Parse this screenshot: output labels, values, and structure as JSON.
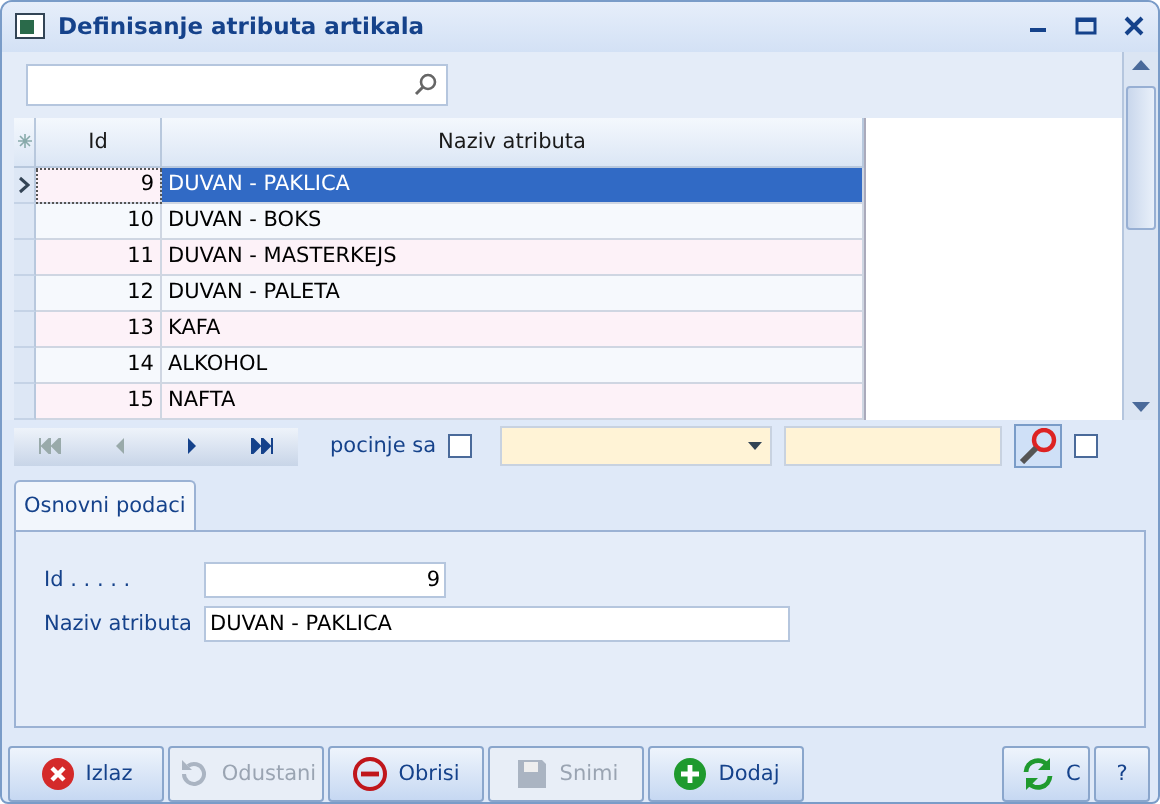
{
  "window": {
    "title": "Definisanje atributa artikala"
  },
  "grid": {
    "columns": [
      "Id",
      "Naziv atributa"
    ],
    "rows": [
      {
        "id": "9",
        "name": "DUVAN - PAKLICA",
        "selected": true
      },
      {
        "id": "10",
        "name": "DUVAN - BOKS",
        "selected": false
      },
      {
        "id": "11",
        "name": "DUVAN - MASTERKEJS",
        "selected": false
      },
      {
        "id": "12",
        "name": "DUVAN - PALETA",
        "selected": false
      },
      {
        "id": "13",
        "name": "KAFA",
        "selected": false
      },
      {
        "id": "14",
        "name": "ALKOHOL",
        "selected": false
      },
      {
        "id": "15",
        "name": "NAFTA",
        "selected": false
      }
    ]
  },
  "filter": {
    "label": "pocinje sa",
    "starts_with_checked": false,
    "extra_checked": false
  },
  "tabs": [
    {
      "label": "Osnovni podaci",
      "selected": true
    }
  ],
  "form": [
    {
      "label": "Id . . . . .",
      "value": "9",
      "kind": "number"
    },
    {
      "label": "Naziv atributa",
      "value": "DUVAN - PAKLICA",
      "kind": "text"
    }
  ],
  "buttons": [
    {
      "label": "Izlaz",
      "kind": "exit",
      "disabled": false
    },
    {
      "label": "Odustani",
      "kind": "undo",
      "disabled": true
    },
    {
      "label": "Obrisi",
      "kind": "delete",
      "disabled": false
    },
    {
      "label": "Snimi",
      "kind": "save",
      "disabled": true
    },
    {
      "label": "Dodaj",
      "kind": "add",
      "disabled": false
    }
  ],
  "refresh_button": {
    "label": "C"
  },
  "help_button": {
    "label": "?"
  }
}
